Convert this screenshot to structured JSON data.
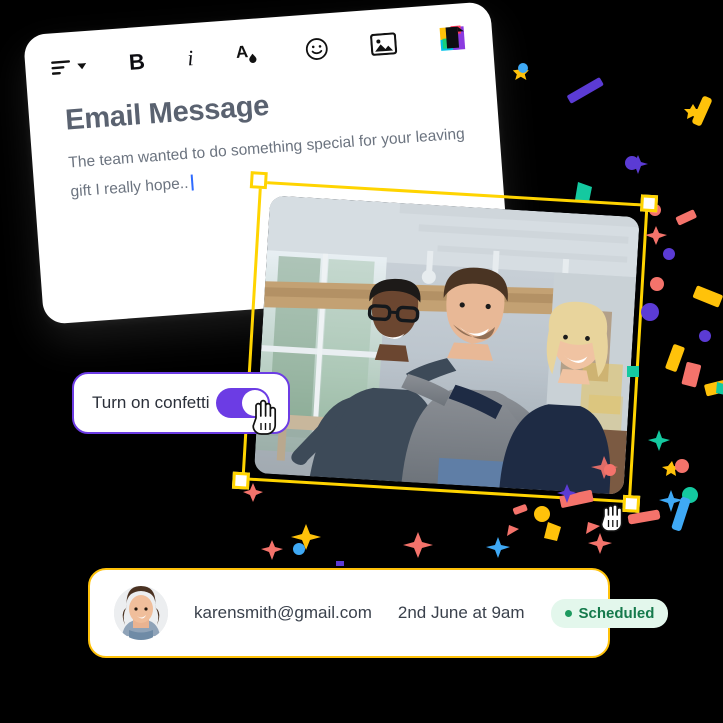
{
  "editor": {
    "toolbar": [
      {
        "name": "align-icon",
        "label": "align",
        "type": "align"
      },
      {
        "name": "bold-icon",
        "label": "B",
        "type": "bold"
      },
      {
        "name": "italic-icon",
        "label": "i",
        "type": "italic"
      },
      {
        "name": "text-color-icon",
        "label": "A",
        "type": "textcolor"
      },
      {
        "name": "emoji-icon",
        "label": "☺",
        "type": "emoji"
      },
      {
        "name": "image-icon",
        "label": "image",
        "type": "image"
      },
      {
        "name": "confetti-icon",
        "label": "confetti",
        "type": "confetti"
      }
    ],
    "title": "Email Message",
    "body": "The team wanted to do something special for your leaving gift I really hope.."
  },
  "toggle": {
    "label": "Turn on confetti",
    "state": "on",
    "accent_color": "#6C3CE4"
  },
  "selection": {
    "frame_color": "#FFD400",
    "handle_count": 4
  },
  "recipient": {
    "avatar_alt": "karen-smith-avatar",
    "email": "karensmith@gmail.com",
    "schedule": "2nd June at 9am",
    "status": "Scheduled",
    "status_bg": "#E3F7EC",
    "status_fg": "#157a4c",
    "border_color": "#FFC20A"
  },
  "confetti_colors": {
    "yellow": "#FFC20A",
    "purple": "#5B3BD4",
    "coral": "#F4736B",
    "teal": "#14C9A0",
    "blue": "#3FA9F5",
    "red": "#E8433A"
  }
}
